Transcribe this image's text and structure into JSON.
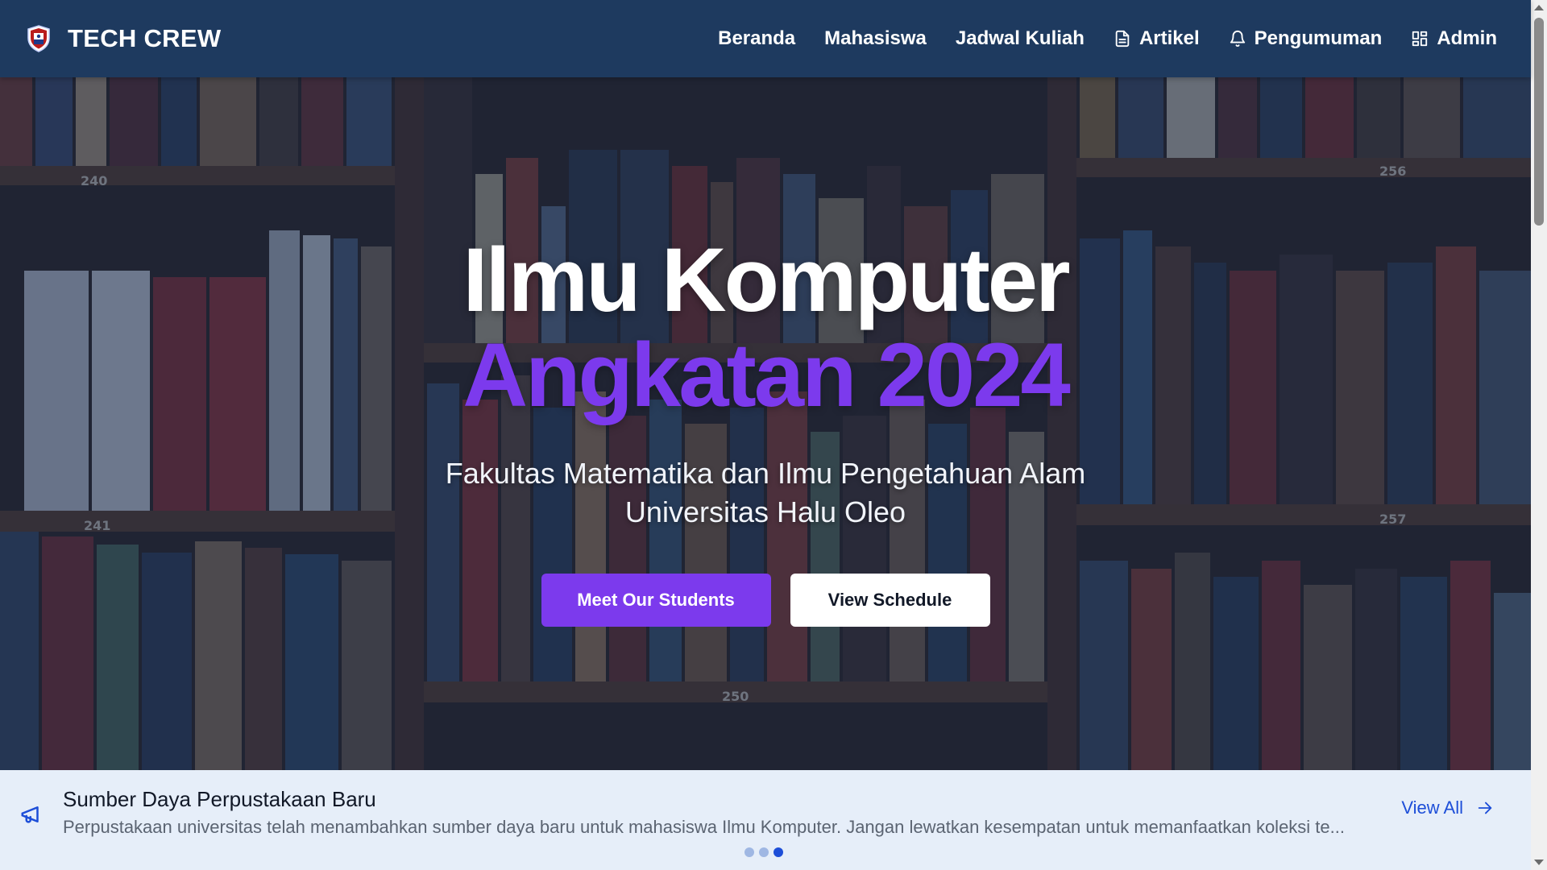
{
  "brand": {
    "name": "TECH CREW",
    "logo_icon": "shield-logo-icon"
  },
  "nav": {
    "items": [
      {
        "label": "Beranda",
        "icon": ""
      },
      {
        "label": "Mahasiswa",
        "icon": ""
      },
      {
        "label": "Jadwal Kuliah",
        "icon": ""
      },
      {
        "label": "Artikel",
        "icon": "document-icon"
      },
      {
        "label": "Pengumuman",
        "icon": "bell-icon"
      },
      {
        "label": "Admin",
        "icon": "grid-icon"
      }
    ]
  },
  "hero": {
    "title": "Ilmu Komputer",
    "subtitle": "Angkatan 2024",
    "description_line1": "Fakultas Matematika dan Ilmu Pengetahuan Alam",
    "description_line2": "Universitas Halu Oleo",
    "primary_button": "Meet Our Students",
    "secondary_button": "View Schedule",
    "shelf_labels": [
      "240",
      "241",
      "250",
      "256",
      "257"
    ]
  },
  "announcement": {
    "icon": "megaphone-icon",
    "title": "Sumber Daya Perpustakaan Baru",
    "text": "Perpustakaan universitas telah menambahkan sumber daya baru untuk mahasiswa Ilmu Komputer. Jangan lewatkan kesempatan untuk memanfaatkan koleksi te...",
    "view_all": "View All",
    "slides_total": 3,
    "slide_active": 3
  },
  "colors": {
    "navbar": "#1e3a5f",
    "accent": "#7c3aed",
    "announcement_bg": "#e6eef9",
    "link": "#1d4ed8"
  }
}
